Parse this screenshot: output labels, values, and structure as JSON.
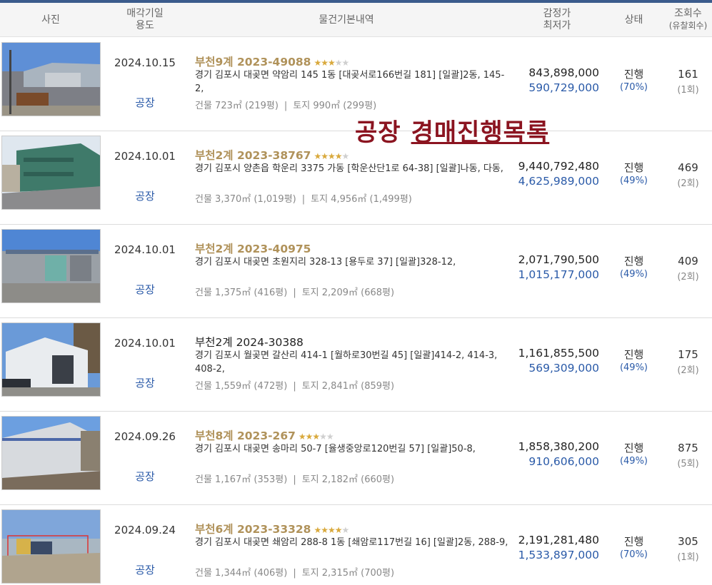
{
  "header": {
    "photo": "사진",
    "date_line1": "매각기일",
    "date_line2": "용도",
    "info": "물건기본내역",
    "price_line1": "감정가",
    "price_line2": "최저가",
    "status": "상태",
    "views_line1": "조회수",
    "views_line2": "(유찰회수)"
  },
  "overlay": {
    "word1": "공장",
    "word2": "경매진행목록"
  },
  "rows": [
    {
      "date": "2024.10.15",
      "usage": "공장",
      "case": "부천9계 2023-49088",
      "stars": 3,
      "address": "경기 김포시 대곶면 약암리 145 1동 [대곶서로166번길 181] [일괄]2동, 145-2,",
      "building": "건물 723㎡ (219평)",
      "land": "토지 990㎡ (299평)",
      "appraisal": "843,898,000",
      "minimum": "590,729,000",
      "status": "진행",
      "rate": "(70%)",
      "views": "161",
      "fails": "(1회)"
    },
    {
      "date": "2024.10.01",
      "usage": "공장",
      "case": "부천2계 2023-38767",
      "stars": 4,
      "address": "경기 김포시 양촌읍 학운리 3375 가동 [학운산단1로 64-38] [일괄]나동, 다동,",
      "building": "건물 3,370㎡ (1,019평)",
      "land": "토지 4,956㎡ (1,499평)",
      "appraisal": "9,440,792,480",
      "minimum": "4,625,989,000",
      "status": "진행",
      "rate": "(49%)",
      "views": "469",
      "fails": "(2회)"
    },
    {
      "date": "2024.10.01",
      "usage": "공장",
      "case": "부천2계 2023-40975",
      "stars": 0,
      "address": "경기 김포시 대곶면 초원지리 328-13 [용두로 37] [일괄]328-12,",
      "building": "건물 1,375㎡ (416평)",
      "land": "토지 2,209㎡ (668평)",
      "appraisal": "2,071,790,500",
      "minimum": "1,015,177,000",
      "status": "진행",
      "rate": "(49%)",
      "views": "409",
      "fails": "(2회)"
    },
    {
      "date": "2024.10.01",
      "usage": "공장",
      "case": "부천2계 2024-30388",
      "stars": 0,
      "address": "경기 김포시 월곶면 갈산리 414-1 [월하로30번길 45] [일괄]414-2, 414-3, 408-2,",
      "building": "건물 1,559㎡ (472평)",
      "land": "토지 2,841㎡ (859평)",
      "appraisal": "1,161,855,500",
      "minimum": "569,309,000",
      "status": "진행",
      "rate": "(49%)",
      "views": "175",
      "fails": "(2회)"
    },
    {
      "date": "2024.09.26",
      "usage": "공장",
      "case": "부천8계 2023-267",
      "stars": 3,
      "address": "경기 김포시 대곶면 송마리 50-7 [율생중앙로120번길 57] [일괄]50-8,",
      "building": "건물 1,167㎡ (353평)",
      "land": "토지 2,182㎡ (660평)",
      "appraisal": "1,858,380,200",
      "minimum": "910,606,000",
      "status": "진행",
      "rate": "(49%)",
      "views": "875",
      "fails": "(5회)"
    },
    {
      "date": "2024.09.24",
      "usage": "공장",
      "case": "부천6계 2023-33328",
      "stars": 4,
      "address": "경기 김포시 대곶면 쇄암리 288-8 1동 [쇄암로117번길 16] [일괄]2동, 288-9,",
      "building": "건물 1,344㎡ (406평)",
      "land": "토지 2,315㎡ (700평)",
      "appraisal": "2,191,281,480",
      "minimum": "1,533,897,000",
      "status": "진행",
      "rate": "(70%)",
      "views": "305",
      "fails": "(1회)"
    }
  ]
}
